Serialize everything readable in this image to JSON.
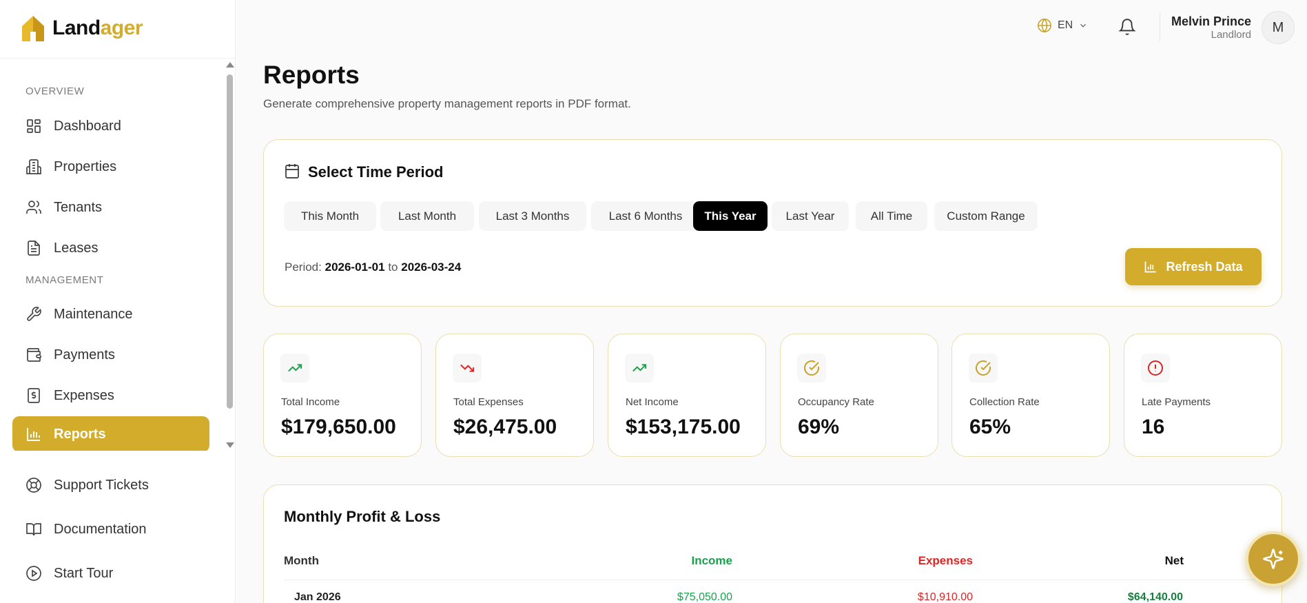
{
  "app": {
    "brand_part1": "Land",
    "brand_part2": "ager",
    "accent_color": "#d4ac2b"
  },
  "sidebar": {
    "sections": {
      "overview": "OVERVIEW",
      "management": "MANAGEMENT"
    },
    "items": [
      {
        "label": "Dashboard",
        "icon": "dashboard-icon"
      },
      {
        "label": "Properties",
        "icon": "building-icon"
      },
      {
        "label": "Tenants",
        "icon": "users-icon"
      },
      {
        "label": "Leases",
        "icon": "document-icon"
      },
      {
        "label": "Maintenance",
        "icon": "wrench-icon"
      },
      {
        "label": "Payments",
        "icon": "wallet-icon"
      },
      {
        "label": "Expenses",
        "icon": "receipt-icon"
      },
      {
        "label": "Reports",
        "icon": "bar-chart-icon",
        "active": true
      }
    ],
    "bottom_items": [
      {
        "label": "Support Tickets",
        "icon": "lifebuoy-icon"
      },
      {
        "label": "Documentation",
        "icon": "book-icon"
      },
      {
        "label": "Start Tour",
        "icon": "play-circle-icon"
      }
    ]
  },
  "topbar": {
    "language": "EN",
    "user_name": "Melvin Prince",
    "user_role": "Landlord",
    "avatar_initial": "M"
  },
  "page": {
    "title": "Reports",
    "subtitle": "Generate comprehensive property management reports in PDF format."
  },
  "period": {
    "title": "Select Time Period",
    "options": [
      "This Month",
      "Last Month",
      "Last 3 Months",
      "Last 6 Months",
      "This Year",
      "Last Year",
      "All Time",
      "Custom Range"
    ],
    "selected": "This Year",
    "label": "Period:",
    "start": "2026-01-01",
    "to": "to",
    "end": "2026-03-24",
    "refresh_label": "Refresh Data"
  },
  "stats": [
    {
      "label": "Total Income",
      "value": "$179,650.00",
      "icon": "trending-up-icon",
      "color": "#16a34a"
    },
    {
      "label": "Total Expenses",
      "value": "$26,475.00",
      "icon": "trending-down-icon",
      "color": "#dc2626"
    },
    {
      "label": "Net Income",
      "value": "$153,175.00",
      "icon": "trending-up-icon",
      "color": "#16a34a"
    },
    {
      "label": "Occupancy Rate",
      "value": "69%",
      "icon": "check-circle-icon",
      "color": "#c9a227"
    },
    {
      "label": "Collection Rate",
      "value": "65%",
      "icon": "check-circle-icon",
      "color": "#c9a227"
    },
    {
      "label": "Late Payments",
      "value": "16",
      "icon": "alert-circle-icon",
      "color": "#dc2626"
    }
  ],
  "profit_loss": {
    "title": "Monthly Profit & Loss",
    "columns": {
      "month": "Month",
      "income": "Income",
      "expenses": "Expenses",
      "net": "Net"
    },
    "rows": [
      {
        "month": "Jan 2026",
        "income": "$75,050.00",
        "expenses": "$10,910.00",
        "net": "$64,140.00"
      }
    ]
  }
}
